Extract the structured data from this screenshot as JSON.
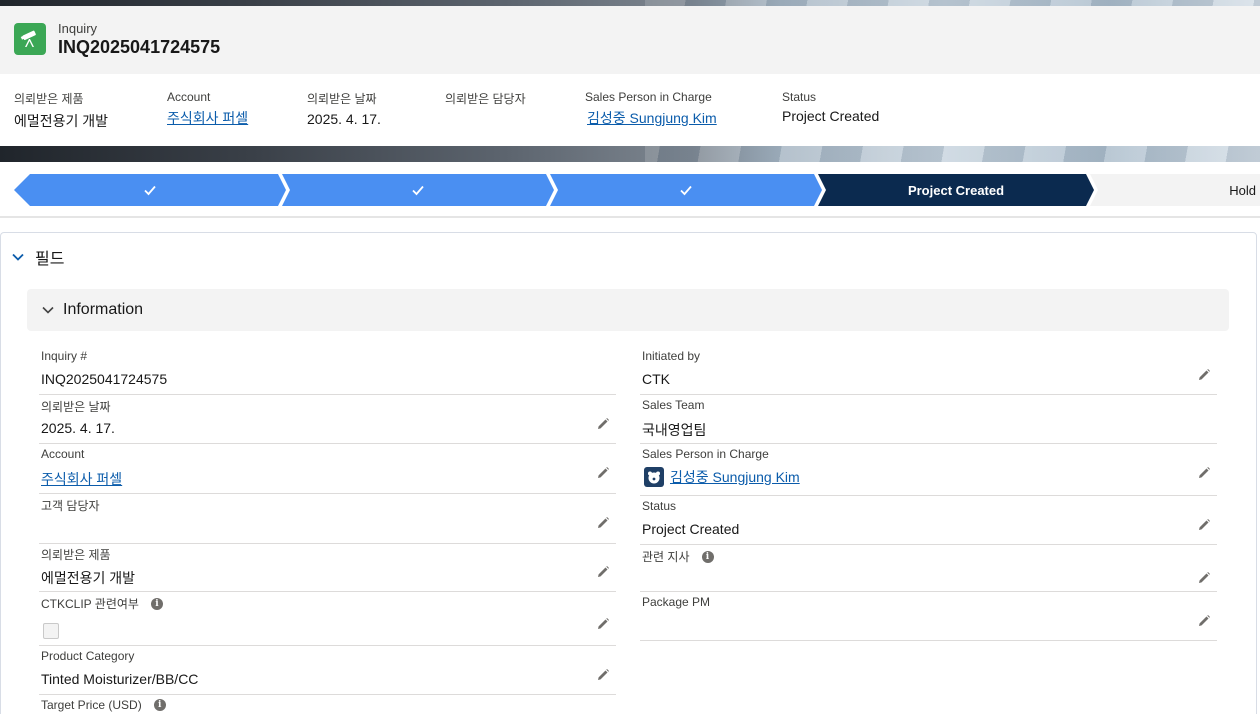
{
  "header": {
    "object_type": "Inquiry",
    "title": "INQ2025041724575",
    "icon": "telescope-icon",
    "fields": [
      {
        "label": "의뢰받은 제품",
        "value": "에멀전용기 개발",
        "link": false
      },
      {
        "label": "Account",
        "value": "주식회사 퍼셀",
        "link": true
      },
      {
        "label": "의뢰받은 날짜",
        "value": "2025. 4. 17.",
        "link": false
      },
      {
        "label": "의뢰받은 담당자",
        "value": "",
        "link": false
      },
      {
        "label": "Sales Person in Charge",
        "value": "김성중 Sungjung Kim",
        "link": true
      },
      {
        "label": "Status",
        "value": "Project Created",
        "link": false
      }
    ]
  },
  "path": {
    "stages": [
      {
        "label": "",
        "state": "complete",
        "icon": "check-icon"
      },
      {
        "label": "",
        "state": "complete",
        "icon": "check-icon"
      },
      {
        "label": "",
        "state": "complete",
        "icon": "check-icon"
      },
      {
        "label": "Project Created",
        "state": "current"
      },
      {
        "label": "Hold",
        "state": "incomplete"
      }
    ]
  },
  "section": {
    "title": "필드",
    "subsection_title": "Information"
  },
  "left_fields": [
    {
      "label": "Inquiry #",
      "value": "INQ2025041724575",
      "editable": false
    },
    {
      "label": "의뢰받은 날짜",
      "value": "2025. 4. 17.",
      "editable": true
    },
    {
      "label": "Account",
      "value": "주식회사 퍼셀",
      "editable": true,
      "link": true
    },
    {
      "label": "고객 담당자",
      "value": "",
      "editable": true
    },
    {
      "label": "의뢰받은 제품",
      "value": "에멀전용기 개발",
      "editable": true
    },
    {
      "label": "CTKCLIP 관련여부",
      "value": "",
      "editable": true,
      "info": true,
      "checkbox": true,
      "checked": false
    },
    {
      "label": "Product Category",
      "value": "Tinted Moisturizer/BB/CC",
      "editable": true
    },
    {
      "label": "Target Price (USD)",
      "value": "",
      "editable": false,
      "info": true
    }
  ],
  "right_fields": [
    {
      "label": "Initiated by",
      "value": "CTK",
      "editable": true
    },
    {
      "label": "Sales Team",
      "value": "국내영업팀",
      "editable": false
    },
    {
      "label": "Sales Person in Charge",
      "value": "김성중 Sungjung Kim",
      "editable": true,
      "link": true,
      "avatar": true
    },
    {
      "label": "Status",
      "value": "Project Created",
      "editable": true
    },
    {
      "label": "관련 지사",
      "value": "",
      "editable": true,
      "info": true
    },
    {
      "label": "Package PM",
      "value": "",
      "editable": true
    }
  ],
  "colors": {
    "accent": "#0b5cab",
    "path_complete": "#4a8ff2",
    "path_current": "#0b2a4f",
    "icon_bg": "#3ba755"
  }
}
